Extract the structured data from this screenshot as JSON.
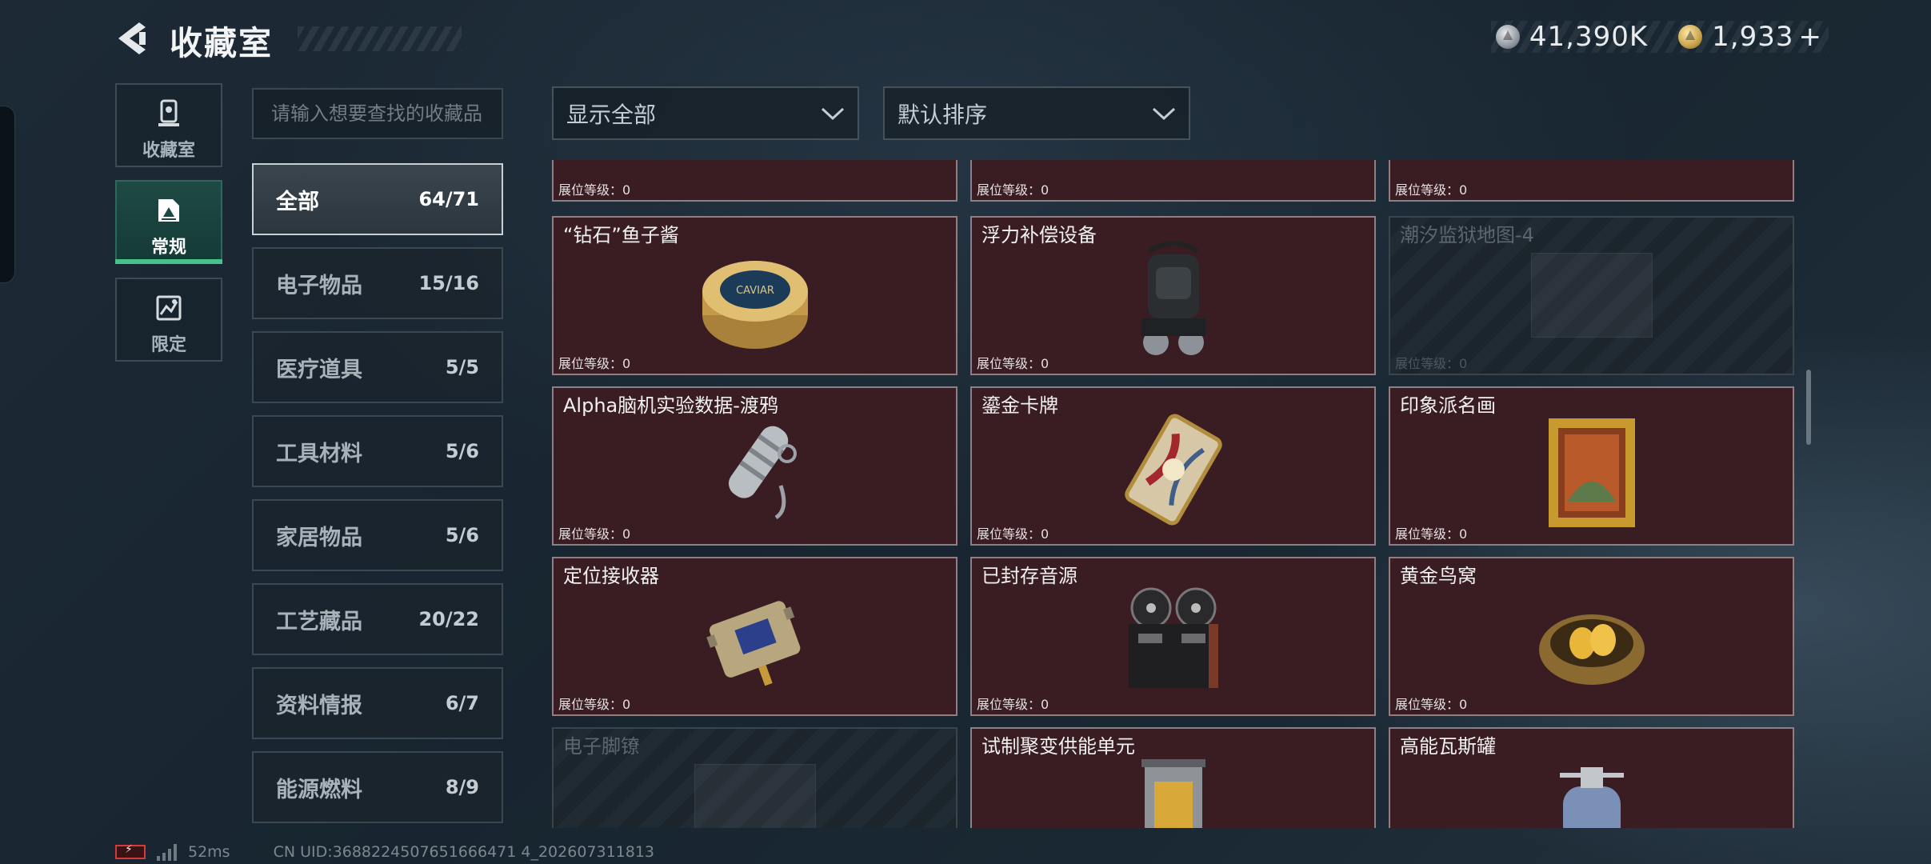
{
  "header": {
    "title": "收藏室",
    "currency": [
      {
        "icon": "silver-coin-icon",
        "value": "41,390K"
      },
      {
        "icon": "gold-coin-icon",
        "value": "1,933",
        "add_label": "+"
      }
    ]
  },
  "side_nav": [
    {
      "label": "收藏室",
      "icon": "collection-room-icon",
      "active": false
    },
    {
      "label": "常规",
      "icon": "regular-icon",
      "active": true
    },
    {
      "label": "限定",
      "icon": "limited-icon",
      "active": false
    }
  ],
  "search": {
    "placeholder": "请输入想要查找的收藏品",
    "value": ""
  },
  "categories": [
    {
      "name": "全部",
      "count": "64/71",
      "active": true
    },
    {
      "name": "电子物品",
      "count": "15/16"
    },
    {
      "name": "医疗道具",
      "count": "5/5"
    },
    {
      "name": "工具材料",
      "count": "5/6"
    },
    {
      "name": "家居物品",
      "count": "5/6"
    },
    {
      "name": "工艺藏品",
      "count": "20/22"
    },
    {
      "name": "资料情报",
      "count": "6/7"
    },
    {
      "name": "能源燃料",
      "count": "8/9"
    }
  ],
  "filters": {
    "display": {
      "value": "显示全部"
    },
    "sort": {
      "value": "默认排序"
    }
  },
  "level_label": "展位等级：",
  "items": [
    {
      "name": "",
      "level": "0",
      "locked": false,
      "icon": "partial-item-icon"
    },
    {
      "name": "",
      "level": "0",
      "locked": false,
      "icon": "partial-item-icon"
    },
    {
      "name": "",
      "level": "0",
      "locked": false,
      "icon": "partial-item-icon"
    },
    {
      "name": "“钻石”鱼子酱",
      "level": "0",
      "locked": false,
      "icon": "caviar-tin-icon"
    },
    {
      "name": "浮力补偿设备",
      "level": "0",
      "locked": false,
      "icon": "buoyancy-device-icon"
    },
    {
      "name": "潮汐监狱地图-4",
      "level": "0",
      "locked": true,
      "icon": "map-icon"
    },
    {
      "name": "Alpha脑机实验数据-渡鸦",
      "level": "0",
      "locked": false,
      "icon": "data-capsule-icon"
    },
    {
      "name": "鎏金卡牌",
      "level": "0",
      "locked": false,
      "icon": "gilded-card-icon"
    },
    {
      "name": "印象派名画",
      "level": "0",
      "locked": false,
      "icon": "framed-painting-icon"
    },
    {
      "name": "定位接收器",
      "level": "0",
      "locked": false,
      "icon": "receiver-icon"
    },
    {
      "name": "已封存音源",
      "level": "0",
      "locked": false,
      "icon": "reel-recorder-icon"
    },
    {
      "name": "黄金鸟窝",
      "level": "0",
      "locked": false,
      "icon": "golden-nest-icon"
    },
    {
      "name": "电子脚镣",
      "level": "",
      "locked": true,
      "icon": "ankle-monitor-icon"
    },
    {
      "name": "试制聚变供能单元",
      "level": "",
      "locked": false,
      "icon": "fusion-cell-icon"
    },
    {
      "name": "高能瓦斯罐",
      "level": "",
      "locked": false,
      "icon": "gas-canister-icon"
    }
  ],
  "footer": {
    "ping": "52ms",
    "uid": "CN UID:3688224507651666471 4_202607311813"
  },
  "colors": {
    "card_bg": "#3a1d22",
    "card_border": "#8e7f85",
    "accent_green": "#47c38a"
  }
}
